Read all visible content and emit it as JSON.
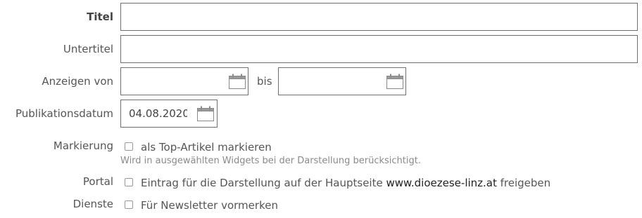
{
  "fields": {
    "titel": {
      "label": "Titel",
      "value": ""
    },
    "untertitel": {
      "label": "Untertitel",
      "value": ""
    },
    "anzeigen": {
      "label": "Anzeigen von",
      "from_value": "",
      "separator": "bis",
      "to_value": ""
    },
    "publikation": {
      "label": "Publikationsdatum",
      "value": "04.08.2020"
    }
  },
  "markierung": {
    "label": "Markierung",
    "checkbox_label": "als Top-Artikel markieren",
    "help": "Wird in ausgewählten Widgets bei der Darstellung berücksichtigt.",
    "checked": false
  },
  "portal": {
    "label": "Portal",
    "text_before": "Eintrag für die Darstellung auf der Hauptseite ",
    "site": "www.dioezese-linz.at",
    "text_after": " freigeben",
    "checked": false
  },
  "dienste": {
    "label": "Dienste",
    "checkbox_label": "Für Newsletter vormerken",
    "checked": false
  },
  "icons": {
    "calendar": "calendar-icon"
  },
  "colors": {
    "border": "#6f6f6f",
    "label": "#555555",
    "help": "#8a8a8a"
  }
}
